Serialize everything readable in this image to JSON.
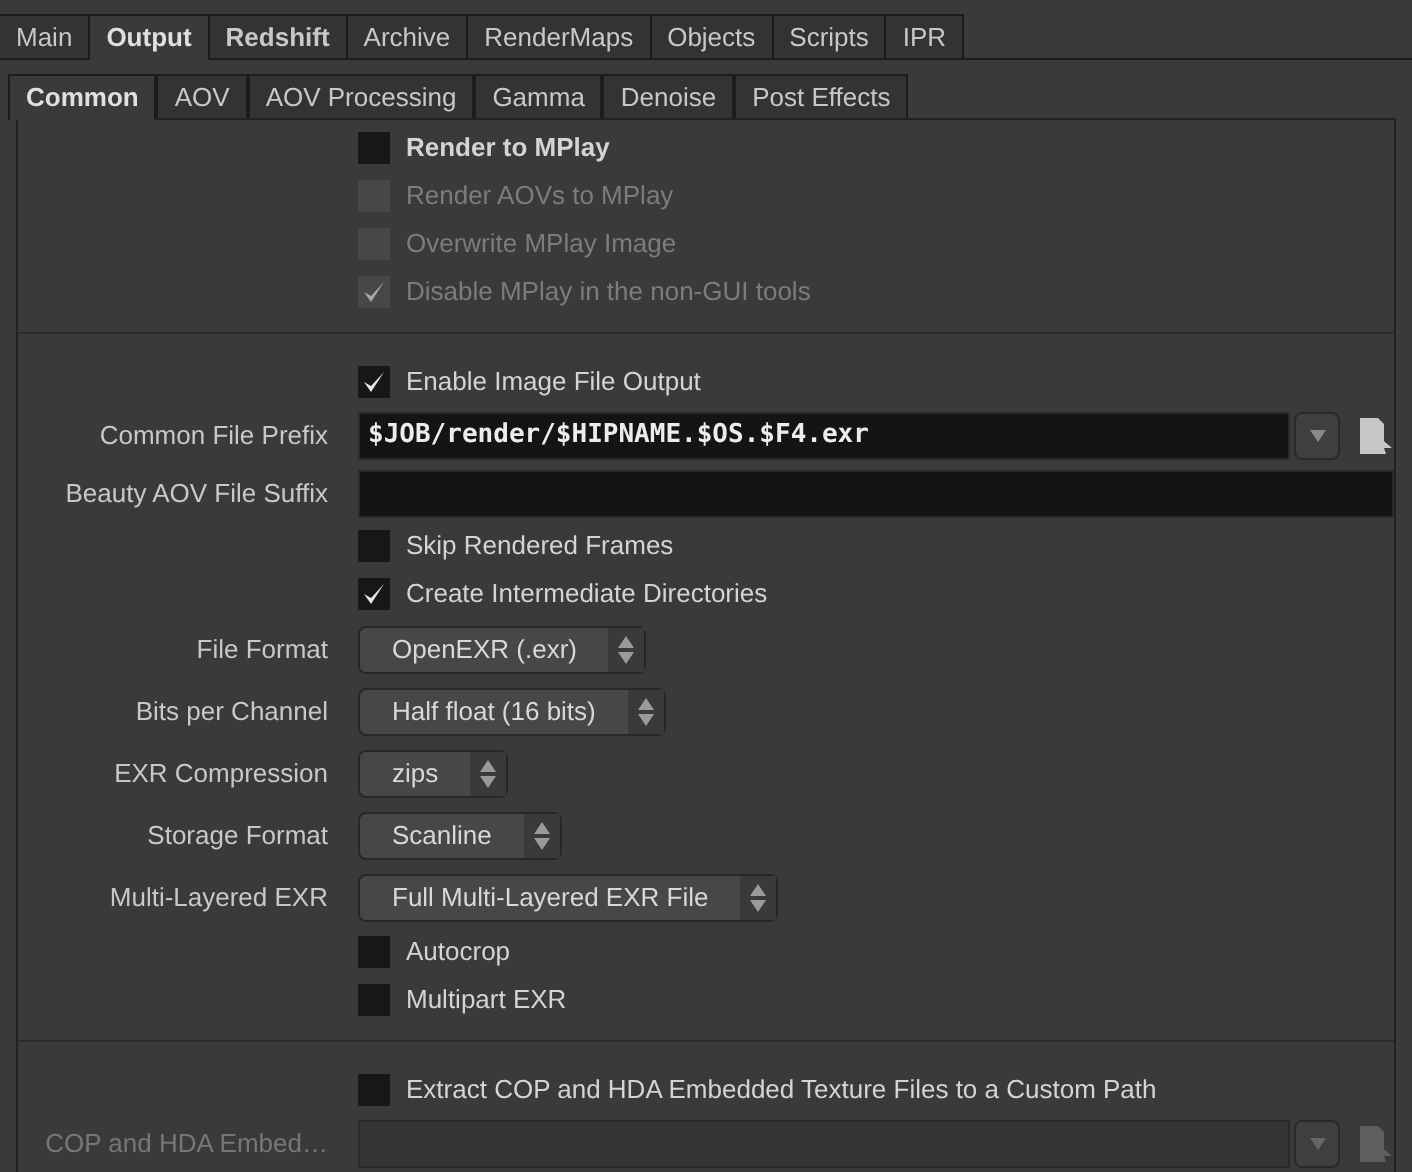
{
  "tabs": [
    {
      "label": "Main",
      "selected": false,
      "bold": false
    },
    {
      "label": "Output",
      "selected": true,
      "bold": true
    },
    {
      "label": "Redshift",
      "selected": false,
      "bold": true
    },
    {
      "label": "Archive",
      "selected": false,
      "bold": false
    },
    {
      "label": "RenderMaps",
      "selected": false,
      "bold": false
    },
    {
      "label": "Objects",
      "selected": false,
      "bold": false
    },
    {
      "label": "Scripts",
      "selected": false,
      "bold": false
    },
    {
      "label": "IPR",
      "selected": false,
      "bold": false
    }
  ],
  "subtabs": [
    {
      "label": "Common",
      "selected": true
    },
    {
      "label": "AOV",
      "selected": false
    },
    {
      "label": "AOV Processing",
      "selected": false
    },
    {
      "label": "Gamma",
      "selected": false
    },
    {
      "label": "Denoise",
      "selected": false
    },
    {
      "label": "Post Effects",
      "selected": false
    }
  ],
  "sections": [
    {
      "rows": [
        {
          "kind": "checkbox",
          "label": "Render to MPlay",
          "checked": false,
          "disabled": false,
          "bold": true
        },
        {
          "kind": "checkbox",
          "label": "Render AOVs to MPlay",
          "checked": false,
          "disabled": true,
          "bold": false
        },
        {
          "kind": "checkbox",
          "label": "Overwrite MPlay Image",
          "checked": false,
          "disabled": true,
          "bold": false
        },
        {
          "kind": "checkbox",
          "label": "Disable MPlay in the non-GUI tools",
          "checked": true,
          "disabled": true,
          "bold": false
        }
      ]
    },
    {
      "rows": [
        {
          "kind": "checkbox",
          "label": "Enable Image File Output",
          "checked": true,
          "disabled": false,
          "bold": false
        },
        {
          "kind": "file",
          "label": "Common File Prefix",
          "value": "$JOB/render/$HIPNAME.$OS.$F4.exr",
          "disabled": false
        },
        {
          "kind": "text",
          "label": "Beauty AOV File Suffix",
          "value": "",
          "disabled": false
        },
        {
          "kind": "checkbox",
          "label": "Skip Rendered Frames",
          "checked": false,
          "disabled": false,
          "bold": false
        },
        {
          "kind": "checkbox",
          "label": "Create Intermediate Directories",
          "checked": true,
          "disabled": false,
          "bold": false
        },
        {
          "kind": "menu",
          "label": "File Format",
          "value": "OpenEXR (.exr)"
        },
        {
          "kind": "menu",
          "label": "Bits per Channel",
          "value": "Half float (16 bits)"
        },
        {
          "kind": "menu",
          "label": "EXR Compression",
          "value": "zips"
        },
        {
          "kind": "menu",
          "label": "Storage Format",
          "value": "Scanline"
        },
        {
          "kind": "menu",
          "label": "Multi-Layered EXR",
          "value": "Full Multi-Layered EXR File"
        },
        {
          "kind": "checkbox",
          "label": "Autocrop",
          "checked": false,
          "disabled": false,
          "bold": false
        },
        {
          "kind": "checkbox",
          "label": "Multipart EXR",
          "checked": false,
          "disabled": false,
          "bold": false
        }
      ]
    },
    {
      "rows": [
        {
          "kind": "checkbox",
          "label": "Extract COP and HDA Embedded Texture Files to a Custom Path",
          "checked": false,
          "disabled": false,
          "bold": false
        },
        {
          "kind": "file",
          "label": "COP and HDA Embed…",
          "value": "",
          "disabled": true
        }
      ]
    }
  ]
}
